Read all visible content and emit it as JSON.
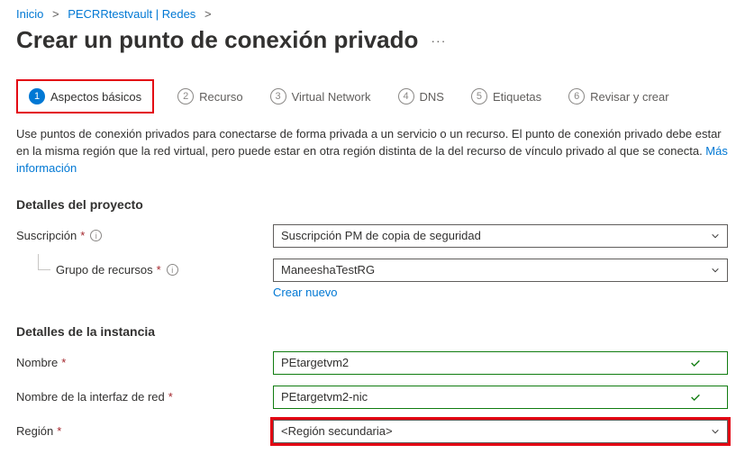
{
  "breadcrumb": {
    "items": [
      {
        "label": "Inicio"
      },
      {
        "label": "PECRRtestvault | Redes"
      }
    ]
  },
  "title": "Crear un punto de conexión privado",
  "tabs": [
    {
      "num": "1",
      "label": "Aspectos básicos"
    },
    {
      "num": "2",
      "label": "Recurso"
    },
    {
      "num": "3",
      "label": "Virtual Network"
    },
    {
      "num": "4",
      "label": "DNS"
    },
    {
      "num": "5",
      "label": "Etiquetas"
    },
    {
      "num": "6",
      "label": "Revisar y crear"
    }
  ],
  "intro": {
    "text": "Use puntos de conexión privados para conectarse de forma privada a un servicio o un recurso. El punto de conexión privado debe estar en la misma región que la red virtual, pero puede estar en otra región distinta de la del recurso de vínculo privado al que se conecta. ",
    "link": "Más información"
  },
  "sections": {
    "project": {
      "header": "Detalles del proyecto",
      "subscription": {
        "label": "Suscripción",
        "value": "Suscripción PM de copia de seguridad"
      },
      "resource_group": {
        "label": "Grupo de recursos",
        "value": "ManeeshaTestRG",
        "create_new": "Crear nuevo"
      }
    },
    "instance": {
      "header": "Detalles de la instancia",
      "name": {
        "label": "Nombre",
        "value": "PEtargetvm2"
      },
      "nic_name": {
        "label": "Nombre de la interfaz de red",
        "value": "PEtargetvm2-nic"
      },
      "region": {
        "label": "Región",
        "value": "<Región secundaria>"
      }
    }
  }
}
